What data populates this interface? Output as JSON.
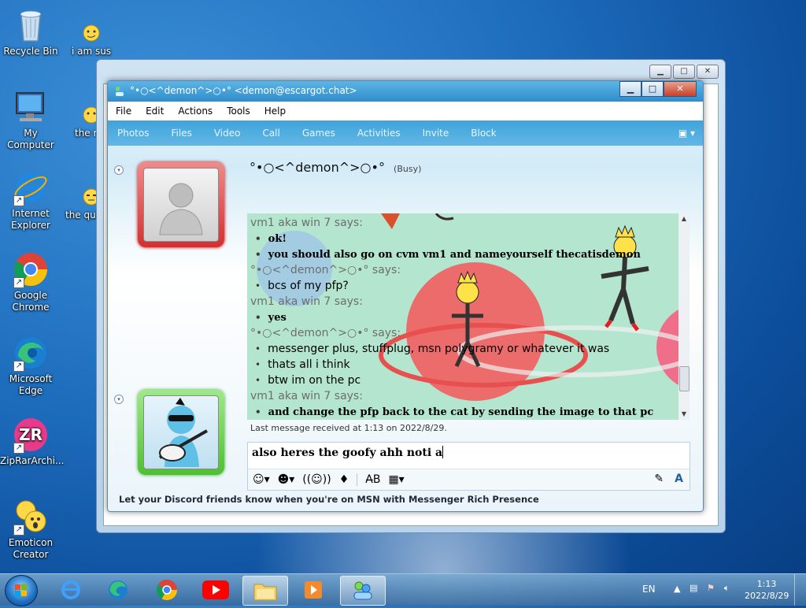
{
  "desktop": {
    "icons": [
      {
        "label": "Recycle Bin"
      },
      {
        "label": "i am sus"
      },
      {
        "label": "My Computer"
      },
      {
        "label": "the ro"
      },
      {
        "label": "Internet Explorer"
      },
      {
        "label": "the qui"
      },
      {
        "label": "Google Chrome"
      },
      {
        "label": "Microsoft Edge"
      },
      {
        "label": "ZipRarArchi..."
      },
      {
        "label": "Emoticon Creator"
      }
    ]
  },
  "messenger": {
    "title": "°•○<^demon^>○•° <demon@escargot.chat>",
    "menu": [
      "File",
      "Edit",
      "Actions",
      "Tools",
      "Help"
    ],
    "toolbar": [
      "Photos",
      "Files",
      "Video",
      "Call",
      "Games",
      "Activities",
      "Invite",
      "Block"
    ],
    "contact": {
      "name": "°•○<^demon^>○•°",
      "status": "(Busy)"
    },
    "chat": [
      {
        "type": "says",
        "text": "vm1 aka win 7 says:"
      },
      {
        "type": "msgb",
        "text": "ok!"
      },
      {
        "type": "msgb",
        "text": "you should also go on cvm vm1 and nameyourself thecatisdemon"
      },
      {
        "type": "says",
        "text": "°•○<^demon^>○•° says:"
      },
      {
        "type": "msg",
        "text": "bcs of my pfp?"
      },
      {
        "type": "says",
        "text": "vm1 aka win 7 says:"
      },
      {
        "type": "msgb",
        "text": "yes"
      },
      {
        "type": "says",
        "text": "°•○<^demon^>○•° says:"
      },
      {
        "type": "msg",
        "text": "messenger plus, stuffplug, msn polygramy or whatever it was"
      },
      {
        "type": "msg",
        "text": "thats all i think"
      },
      {
        "type": "msg",
        "text": "btw im on the pc"
      },
      {
        "type": "says",
        "text": "vm1 aka win 7 says:"
      },
      {
        "type": "msgb",
        "text": "and change the pfp back to the cat by sending the image to that pc"
      }
    ],
    "last_message": "Last message received at 1:13 on 2022/8/29.",
    "input_text": "also heres the goofy ahh noti a",
    "footer_ad": "Let your Discord friends know when you're on MSN with Messenger Rich Presence"
  },
  "taskbar": {
    "language": "EN",
    "time": "1:13",
    "date": "2022/8/29"
  }
}
